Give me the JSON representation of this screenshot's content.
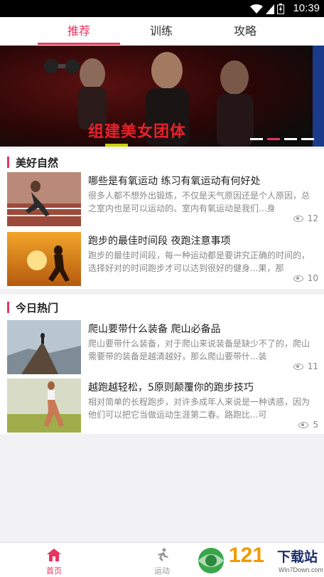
{
  "status": {
    "time": "10:39"
  },
  "tabs": [
    {
      "label": "推荐",
      "active": true
    },
    {
      "label": "训练",
      "active": false
    },
    {
      "label": "攻略",
      "active": false
    }
  ],
  "banner": {
    "title": "组建美女团体",
    "dots": 4,
    "active_dot": 1
  },
  "sections": [
    {
      "title": "美好自然",
      "articles": [
        {
          "title": "哪些是有氧运动 练习有氧运动有何好处",
          "desc": "很多人都不想外出锻炼，不仅是天气原因还是个人原因，总之室内也是可以运动的。室内有氧运动是我们...身",
          "views": "12"
        },
        {
          "title": "跑步的最佳时间段 夜跑注意事项",
          "desc": "跑步的最佳时间段，每一种运动都是要讲究正确的时间的，选择好对的时间跑步才可以达到很好的健身...果，那",
          "views": "10"
        }
      ]
    },
    {
      "title": "今日热门",
      "articles": [
        {
          "title": "爬山要带什么装备 爬山必备品",
          "desc": "爬山要带什么装备，对于爬山来说装备是缺少不了的，爬山需要带的装备是越清越好，那么爬山要带什...装",
          "views": "11"
        },
        {
          "title": "越跑越轻松，5原则颠覆你的跑步技巧",
          "desc": "相对简单的长程跑步，对许多成年人来说是一种诱惑，因为他们可以把它当做运动生涯第二春。路跑比...可",
          "views": "5"
        }
      ]
    }
  ],
  "bottomnav": [
    {
      "label": "首页",
      "icon": "home-icon",
      "active": true
    },
    {
      "label": "运动",
      "icon": "runner-icon",
      "active": false
    }
  ],
  "watermark": {
    "number": "121",
    "text": "下载站",
    "url": "Win7Down.com"
  },
  "colors": {
    "accent": "#e8345e"
  }
}
